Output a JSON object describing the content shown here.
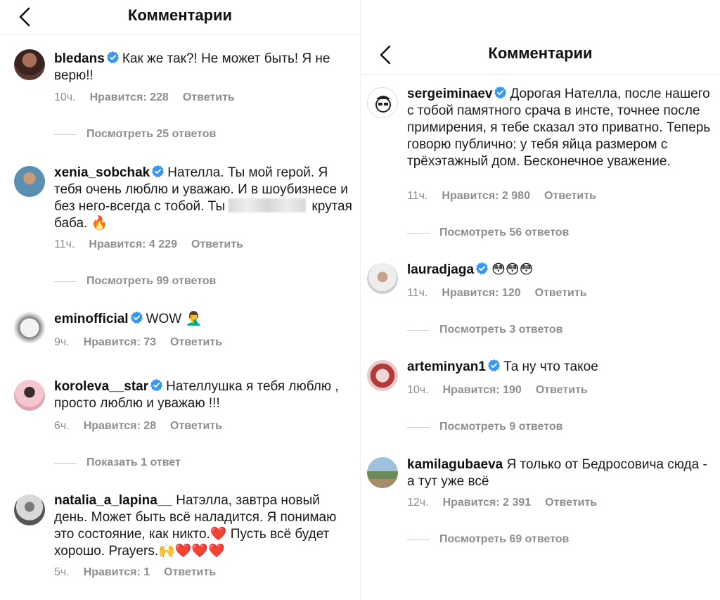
{
  "left": {
    "header": {
      "title": "Комментарии"
    },
    "comments": [
      {
        "user": "bledans",
        "text": "Как же так?! Не может быть! Я не верю!!",
        "time": "10ч.",
        "likes": "Нравится: 228",
        "reply": "Ответить",
        "replies": "Посмотреть 25 ответов"
      },
      {
        "user": "xenia_sobchak",
        "text_a": "Нателла. Ты мой герой. Я тебя очень люблю и уважаю. И в шоубизнесе и без него-всегда с тобой. Ты",
        "text_b": "крутая баба.",
        "emoji": "🔥",
        "time": "11ч.",
        "likes": "Нравится: 4 229",
        "reply": "Ответить",
        "replies": "Посмотреть 99 ответов"
      },
      {
        "user": "eminofficial",
        "text": "WOW",
        "emoji": "🤦‍♂️",
        "time": "9ч.",
        "likes": "Нравится: 73",
        "reply": "Ответить"
      },
      {
        "user": "koroleva__star",
        "text": "Нателлушка я тебя люблю , просто люблю и уважаю !!!",
        "time": "6ч.",
        "likes": "Нравится: 28",
        "reply": "Ответить",
        "replies": "Показать 1 ответ"
      },
      {
        "user": "natalia_a_lapina__",
        "text_a": "Натэлла, завтра новый день. Может быть всё наладится. Я понимаю это состояние, как никто.",
        "heart1": "❤️",
        "text_b": "Пусть всё будет хорошо. Prayers.",
        "emoji_b": "🙌❤️❤️❤️",
        "time": "5ч.",
        "likes": "Нравится: 1",
        "reply": "Ответить"
      }
    ]
  },
  "right": {
    "header": {
      "title": "Комментарии"
    },
    "comments": [
      {
        "user": "sergeiminaev",
        "text": "Дорогая Нателла, после нашего с тобой памятного срача в инсте, точнее после примирения, я тебе сказал это приватно. Теперь говорю публично: у тебя яйца размером с трёхэтажный дом. Бесконечное уважение.",
        "time": "11ч.",
        "likes": "Нравится: 2 980",
        "reply": "Ответить",
        "replies": "Посмотреть 56 ответов"
      },
      {
        "user": "lauradjaga",
        "emoji": "😳😳😳",
        "time": "11ч.",
        "likes": "Нравится: 120",
        "reply": "Ответить",
        "replies": "Посмотреть 3 ответов"
      },
      {
        "user": "arteminyan1",
        "text": "Та ну что такое",
        "time": "10ч.",
        "likes": "Нравится: 190",
        "reply": "Ответить",
        "replies": "Посмотреть 9 ответов"
      },
      {
        "user": "kamilagubaeva",
        "text": "Я только от Бедросовича сюда - а тут уже всё",
        "time": "12ч.",
        "likes": "Нравится: 2 391",
        "reply": "Ответить",
        "replies": "Посмотреть 69 ответов"
      }
    ]
  },
  "colors": {
    "verified": "#3897f0",
    "meta": "#8e8e8e",
    "text": "#111111"
  }
}
